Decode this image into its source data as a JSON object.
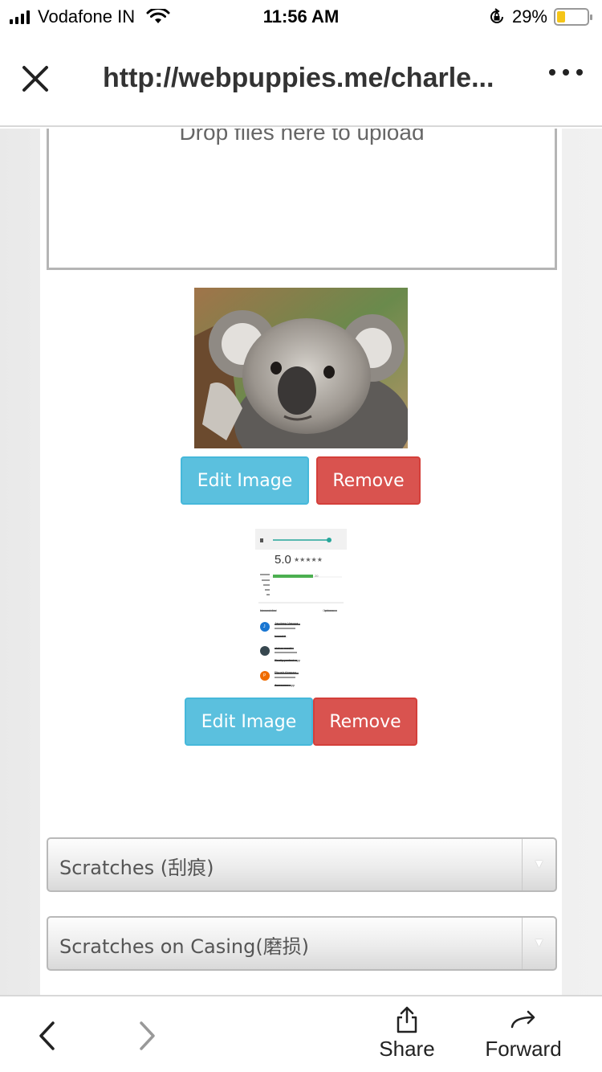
{
  "status_bar": {
    "carrier": "Vodafone IN",
    "time": "11:56 AM",
    "battery": "29%",
    "battery_level": 0.29
  },
  "url_bar": {
    "url": "http://webpuppies.me/charle...",
    "close_icon": "close-icon",
    "more_icon": "more-icon"
  },
  "upload": {
    "dropzone_text": "Drop files here to upload"
  },
  "images": [
    {
      "edit_label": "Edit Image",
      "remove_label": "Remove"
    },
    {
      "edit_label": "Edit Image",
      "remove_label": "Remove",
      "screenshot": {
        "rating": "5.0",
        "count": "20",
        "sort_label": "Newest first",
        "options_label": "Options",
        "reviews": [
          {
            "initial": "J",
            "name": "Jaydeep Vasoya",
            "text": "Loved it.."
          },
          {
            "initial": "",
            "name": "status masti",
            "text": "Really perfect app"
          },
          {
            "initial": "P",
            "name": "Piyush Airapaa",
            "text": "Awesome app"
          }
        ]
      }
    }
  ],
  "selects": [
    {
      "label": "Scratches (刮痕)"
    },
    {
      "label": "Scratches on Casing(磨损)"
    }
  ],
  "toolbar": {
    "share_label": "Share",
    "forward_label": "Forward"
  },
  "colors": {
    "edit_button": "#5bc0de",
    "remove_button": "#d9534f",
    "battery_fill": "#f5c518"
  }
}
